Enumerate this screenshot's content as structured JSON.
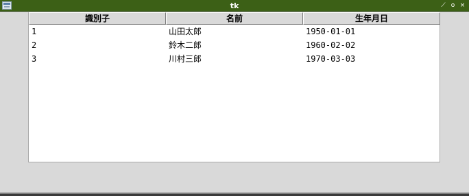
{
  "window": {
    "title": "tk",
    "controls": {
      "minimize_glyph": "⟋",
      "maximize_glyph": "o",
      "close_glyph": "×"
    },
    "colors": {
      "titlebar": "#3c6016",
      "body": "#d9d9d9"
    }
  },
  "table": {
    "columns": [
      "識別子",
      "名前",
      "生年月日"
    ],
    "rows": [
      [
        "1",
        "山田太郎",
        "1950-01-01"
      ],
      [
        "2",
        "鈴木二郎",
        "1960-02-02"
      ],
      [
        "3",
        "川村三郎",
        "1970-03-03"
      ]
    ]
  }
}
